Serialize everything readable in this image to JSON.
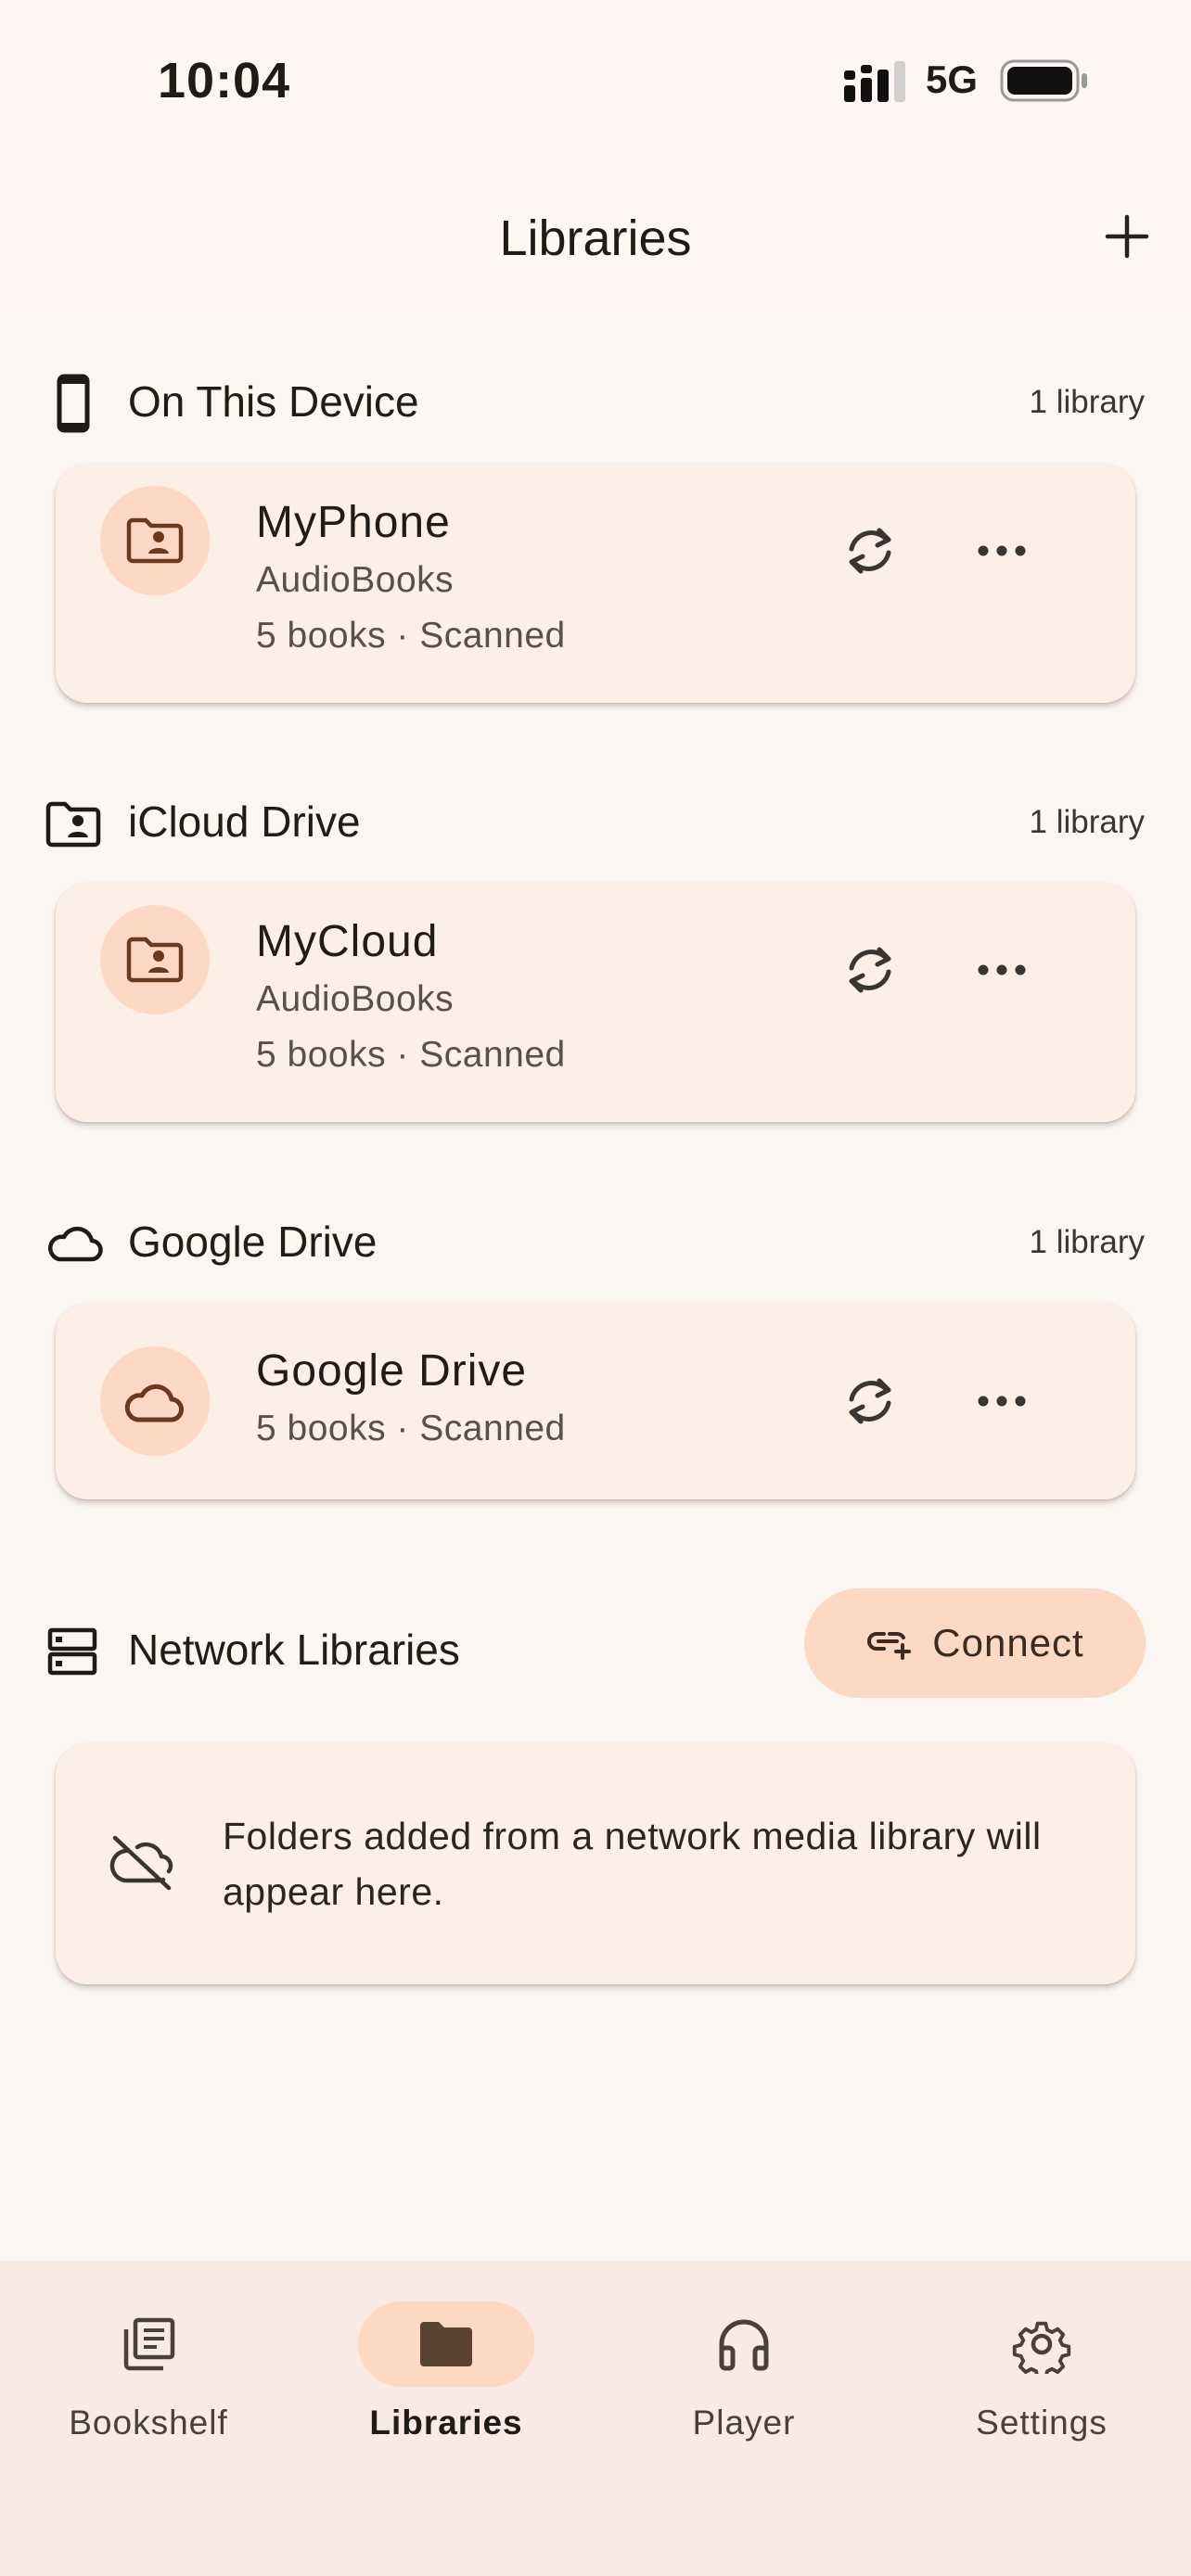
{
  "status_bar": {
    "time": "10:04",
    "network": "5G"
  },
  "header": {
    "title": "Libraries",
    "add_icon": "plus-icon"
  },
  "sections": {
    "device": {
      "title": "On This Device",
      "count": "1 library",
      "icon": "phone-icon",
      "card": {
        "icon": "folder-person-icon",
        "title": "MyPhone",
        "subtitle": "AudioBooks",
        "meta": "5 books · Scanned"
      }
    },
    "icloud": {
      "title": "iCloud Drive",
      "count": "1 library",
      "icon": "folder-person-icon",
      "card": {
        "icon": "folder-person-icon",
        "title": "MyCloud",
        "subtitle": "AudioBooks",
        "meta": "5 books · Scanned"
      }
    },
    "google": {
      "title": "Google Drive",
      "count": "1 library",
      "icon": "cloud-icon",
      "card": {
        "icon": "cloud-icon",
        "title": "Google Drive",
        "meta": "5 books · Scanned"
      }
    },
    "network": {
      "title": "Network Libraries",
      "icon": "server-icon",
      "connect_label": "Connect",
      "connect_icon": "add-link-icon",
      "empty_icon": "cloud-off-icon",
      "empty_text": "Folders added from a network media library will appear here."
    }
  },
  "bottom_nav": {
    "items": [
      {
        "label": "Bookshelf",
        "icon": "library-books-icon"
      },
      {
        "label": "Libraries",
        "icon": "folder-icon",
        "active": true
      },
      {
        "label": "Player",
        "icon": "headphones-icon"
      },
      {
        "label": "Settings",
        "icon": "gear-icon"
      }
    ]
  },
  "colors": {
    "background": "#faf6f2",
    "card": "#fdeee6",
    "accent": "#fdd9c5",
    "icon_brown": "#6b3a1e"
  }
}
